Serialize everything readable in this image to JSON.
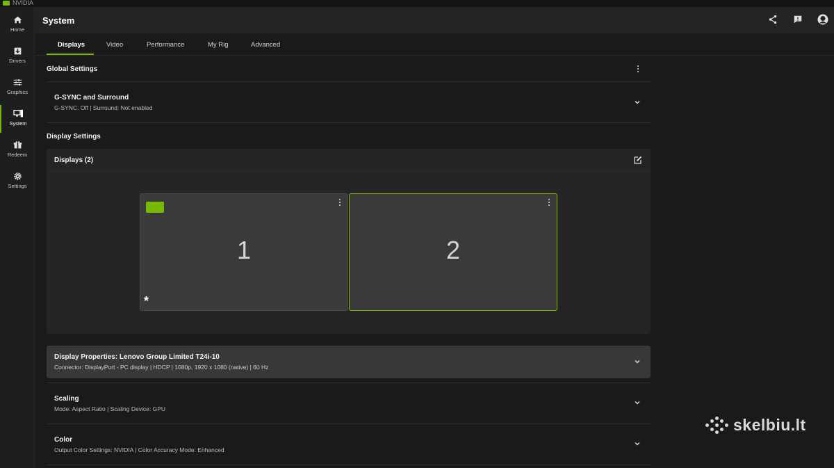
{
  "brand": {
    "name": "NVIDIA"
  },
  "sidebar": {
    "items": [
      {
        "label": "Home",
        "icon": "home-icon"
      },
      {
        "label": "Drivers",
        "icon": "drivers-icon"
      },
      {
        "label": "Graphics",
        "icon": "sliders-icon"
      },
      {
        "label": "System",
        "icon": "system-icon",
        "active": true
      },
      {
        "label": "Redeem",
        "icon": "gift-icon"
      },
      {
        "label": "Settings",
        "icon": "gear-icon"
      }
    ]
  },
  "header": {
    "title": "System",
    "icons": [
      "share-icon",
      "feedback-icon",
      "avatar-icon"
    ]
  },
  "tabs": [
    {
      "label": "Displays",
      "active": true
    },
    {
      "label": "Video"
    },
    {
      "label": "Performance"
    },
    {
      "label": "My Rig"
    },
    {
      "label": "Advanced"
    }
  ],
  "global_settings": {
    "title": "Global Settings",
    "gsync": {
      "title": "G-SYNC and Surround",
      "subtitle": "G-SYNC: Off | Surround: Not enabled"
    }
  },
  "display_settings": {
    "title": "Display Settings",
    "panel_title": "Displays (2)",
    "monitors": [
      {
        "number": "1",
        "primary_marker": "*"
      },
      {
        "number": "2"
      }
    ]
  },
  "display_properties": {
    "title": "Display Properties: Lenovo Group Limited T24i-10",
    "subtitle": "Connector: DisplayPort - PC display | HDCP | 1080p, 1920 x 1080 (native) | 60 Hz"
  },
  "scaling": {
    "title": "Scaling",
    "subtitle": "Mode: Aspect Ratio | Scaling Device: GPU"
  },
  "color": {
    "title": "Color",
    "subtitle": "Output Color Settings: NVIDIA | Color Accuracy Mode: Enhanced"
  },
  "watermark": {
    "text": "skelbiu.lt"
  },
  "colors": {
    "accent": "#76b900",
    "background": "#1a1a1a",
    "panel": "#252525"
  }
}
